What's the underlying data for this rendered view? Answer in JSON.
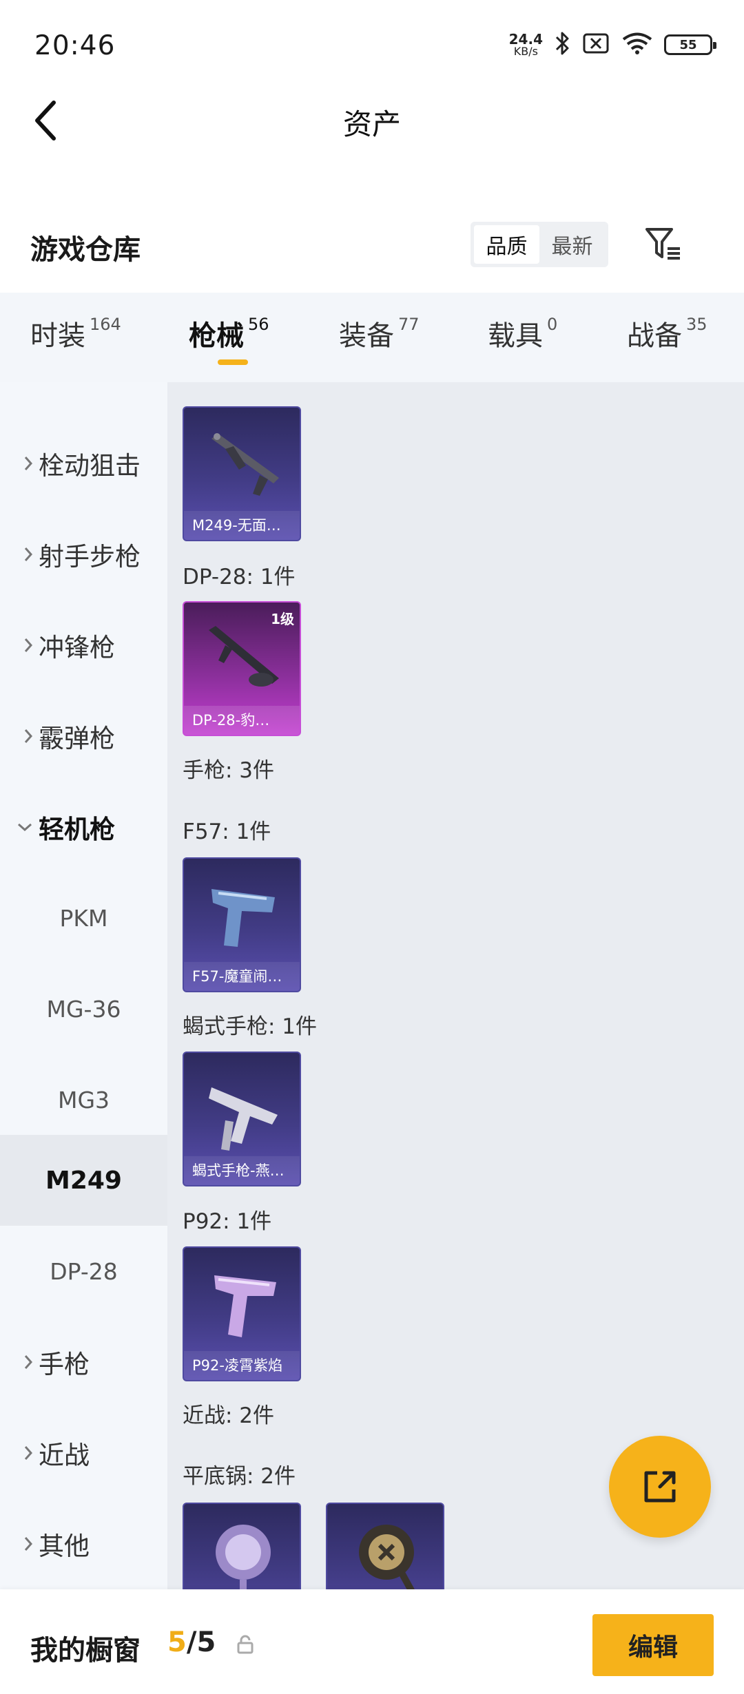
{
  "status_bar": {
    "time": "20:46",
    "net_speed_value": "24.4",
    "net_speed_unit": "KB/s",
    "battery": "55",
    "icons": [
      "bluetooth-icon",
      "sim-disabled-icon",
      "wifi-icon",
      "battery-icon"
    ]
  },
  "app_bar": {
    "title": "资产",
    "back_icon": "chevron-left-icon"
  },
  "section": {
    "title": "游戏仓库",
    "sort_options": [
      "品质",
      "最新"
    ],
    "sort_selected": "品质",
    "filter_icon": "filter-icon"
  },
  "tabs": [
    {
      "label": "时装",
      "count": "164"
    },
    {
      "label": "枪械",
      "count": "56",
      "active": true
    },
    {
      "label": "装备",
      "count": "77"
    },
    {
      "label": "载具",
      "count": "0"
    },
    {
      "label": "战备",
      "count": "35"
    }
  ],
  "sidebar": {
    "items": [
      {
        "label": "栓动狙击",
        "type": "category"
      },
      {
        "label": "射手步枪",
        "type": "category"
      },
      {
        "label": "冲锋枪",
        "type": "category"
      },
      {
        "label": "霰弹枪",
        "type": "category"
      },
      {
        "label": "轻机枪",
        "type": "category",
        "expanded": true
      },
      {
        "label": "PKM",
        "type": "sub"
      },
      {
        "label": "MG-36",
        "type": "sub"
      },
      {
        "label": "MG3",
        "type": "sub"
      },
      {
        "label": "M249",
        "type": "sub",
        "selected": true
      },
      {
        "label": "DP-28",
        "type": "sub"
      },
      {
        "label": "手枪",
        "type": "category"
      },
      {
        "label": "近战",
        "type": "category"
      },
      {
        "label": "其他",
        "type": "category"
      }
    ]
  },
  "content": {
    "labels": {
      "dp28": "DP-28: 1件",
      "pistol_group": "手枪: 3件",
      "f57": "F57: 1件",
      "scorpion": "蝎式手枪: 1件",
      "p92": "P92: 1件",
      "melee_group": "近战: 2件",
      "pan": "平底锅: 2件"
    },
    "cards": {
      "m249": {
        "name": "M249-无面…",
        "rarity": "purple"
      },
      "dp28": {
        "name": "DP-28-豹…",
        "level": "1级",
        "rarity": "pink"
      },
      "f57": {
        "name": "F57-魔童闹…",
        "rarity": "purple"
      },
      "scorpion": {
        "name": "蝎式手枪-燕…",
        "rarity": "purple"
      },
      "p92": {
        "name": "P92-凌霄紫焰",
        "rarity": "purple"
      }
    }
  },
  "fab": {
    "icon": "share-external-icon"
  },
  "bottom_bar": {
    "title": "我的橱窗",
    "current": "5",
    "separator": "/",
    "total": "5",
    "lock_icon": "lock-icon",
    "edit_label": "编辑"
  },
  "colors": {
    "accent": "#f6b21a",
    "card_purple": "#423c86",
    "card_pink": "#c23ed0"
  }
}
